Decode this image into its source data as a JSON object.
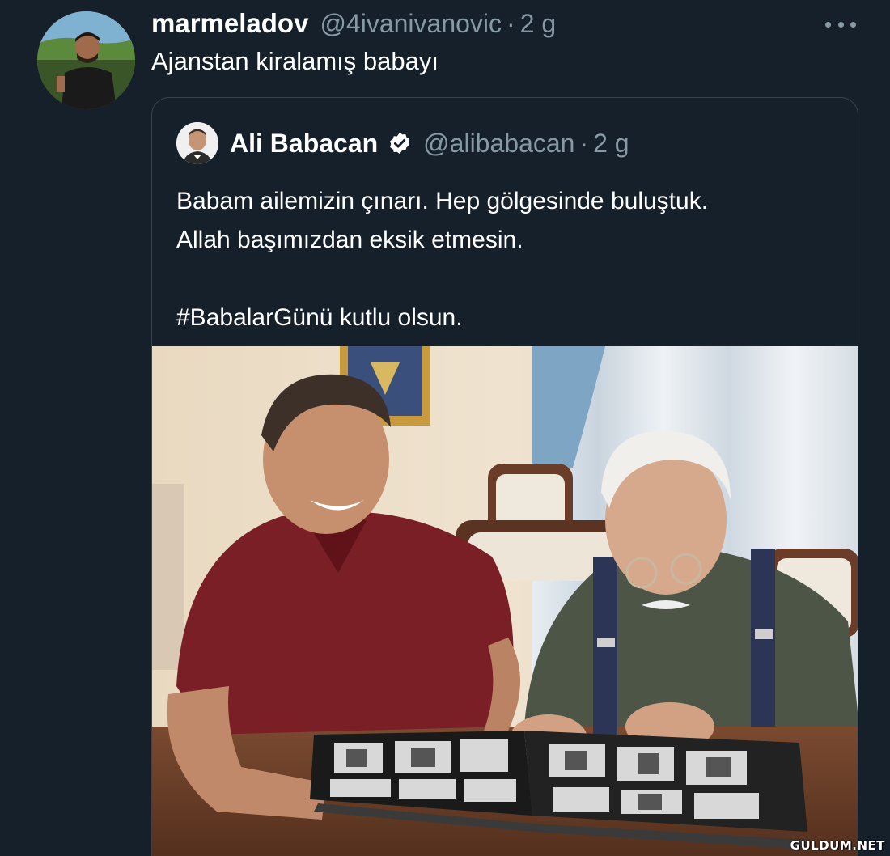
{
  "tweet": {
    "display_name": "marmeladov",
    "handle": "@4ivanivanovic",
    "separator": "·",
    "time": "2 g",
    "text": "Ajanstan kiralamış babayı"
  },
  "quoted_tweet": {
    "display_name": "Ali Babacan",
    "handle": "@alibabacan",
    "separator": "·",
    "time": "2 g",
    "lines": [
      "Babam ailemizin çınarı. Hep gölgesinde buluştuk.",
      "Allah başımızdan eksik etmesin.",
      "#BabalarGünü kutlu olsun."
    ]
  },
  "watermark": "GULDUM.NET",
  "colors": {
    "background": "#15202b",
    "secondary_text": "#8899a6",
    "border": "#38444d"
  },
  "icons": [
    "more-icon",
    "verified-icon"
  ]
}
